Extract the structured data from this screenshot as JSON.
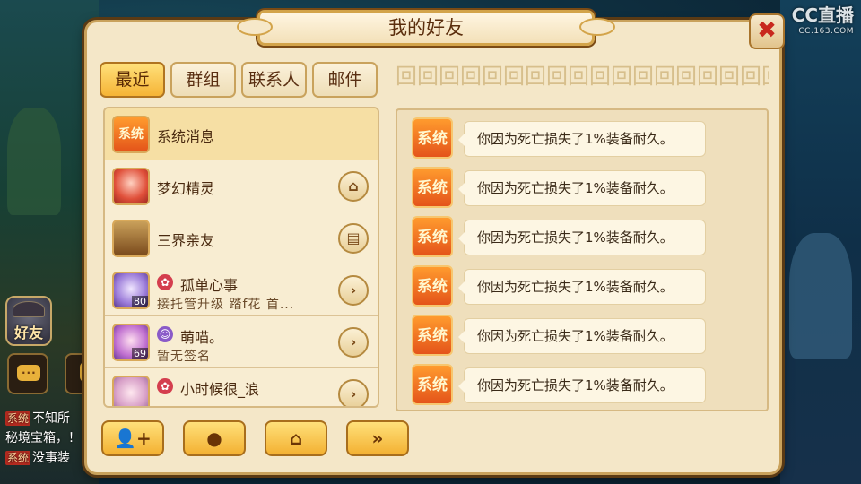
{
  "watermark": {
    "brand": "CC直播",
    "sub": "CC.163.COM"
  },
  "hud": {
    "friend_label": "好友",
    "chat_lines": [
      {
        "tag": "系统",
        "text": "不知所"
      },
      {
        "tag": "",
        "text": "秘境宝箱，！"
      },
      {
        "tag": "系统",
        "text": "没事装"
      }
    ]
  },
  "dialog": {
    "title": "我的好友",
    "close_icon": "close-icon",
    "tabs": [
      {
        "label": "最近",
        "active": true
      },
      {
        "label": "群组",
        "active": false
      },
      {
        "label": "联系人",
        "active": false
      },
      {
        "label": "邮件",
        "active": false
      }
    ],
    "list": [
      {
        "name": "系统消息",
        "avatar_text": "系统",
        "selected": true
      },
      {
        "name": "梦幻精灵",
        "action_icon": "house-icon"
      },
      {
        "name": "三界亲友",
        "action_icon": "book-icon"
      },
      {
        "name": "孤单心事",
        "status": "接托管升级 踏f花 首...",
        "level": "80",
        "mark_icon": "flower-icon",
        "action_icon": "chevron-right-icon"
      },
      {
        "name": "萌喵。",
        "status": "暂无签名",
        "level": "69",
        "mark_icon": "face-icon",
        "action_icon": "chevron-right-icon"
      },
      {
        "name": "小时候很_浪",
        "mark_icon": "flower-icon",
        "action_icon": "chevron-right-icon"
      }
    ],
    "bottom_buttons": [
      {
        "icon": "add-friend-icon"
      },
      {
        "icon": "chat-icon"
      },
      {
        "icon": "home-icon"
      },
      {
        "icon": "double-chevron-icon"
      }
    ],
    "messages": [
      {
        "sender": "系统",
        "text": "你因为死亡损失了1%装备耐久。"
      },
      {
        "sender": "系统",
        "text": "你因为死亡损失了1%装备耐久。"
      },
      {
        "sender": "系统",
        "text": "你因为死亡损失了1%装备耐久。"
      },
      {
        "sender": "系统",
        "text": "你因为死亡损失了1%装备耐久。"
      },
      {
        "sender": "系统",
        "text": "你因为死亡损失了1%装备耐久。"
      },
      {
        "sender": "系统",
        "text": "你因为死亡损失了1%装备耐久。"
      }
    ]
  }
}
